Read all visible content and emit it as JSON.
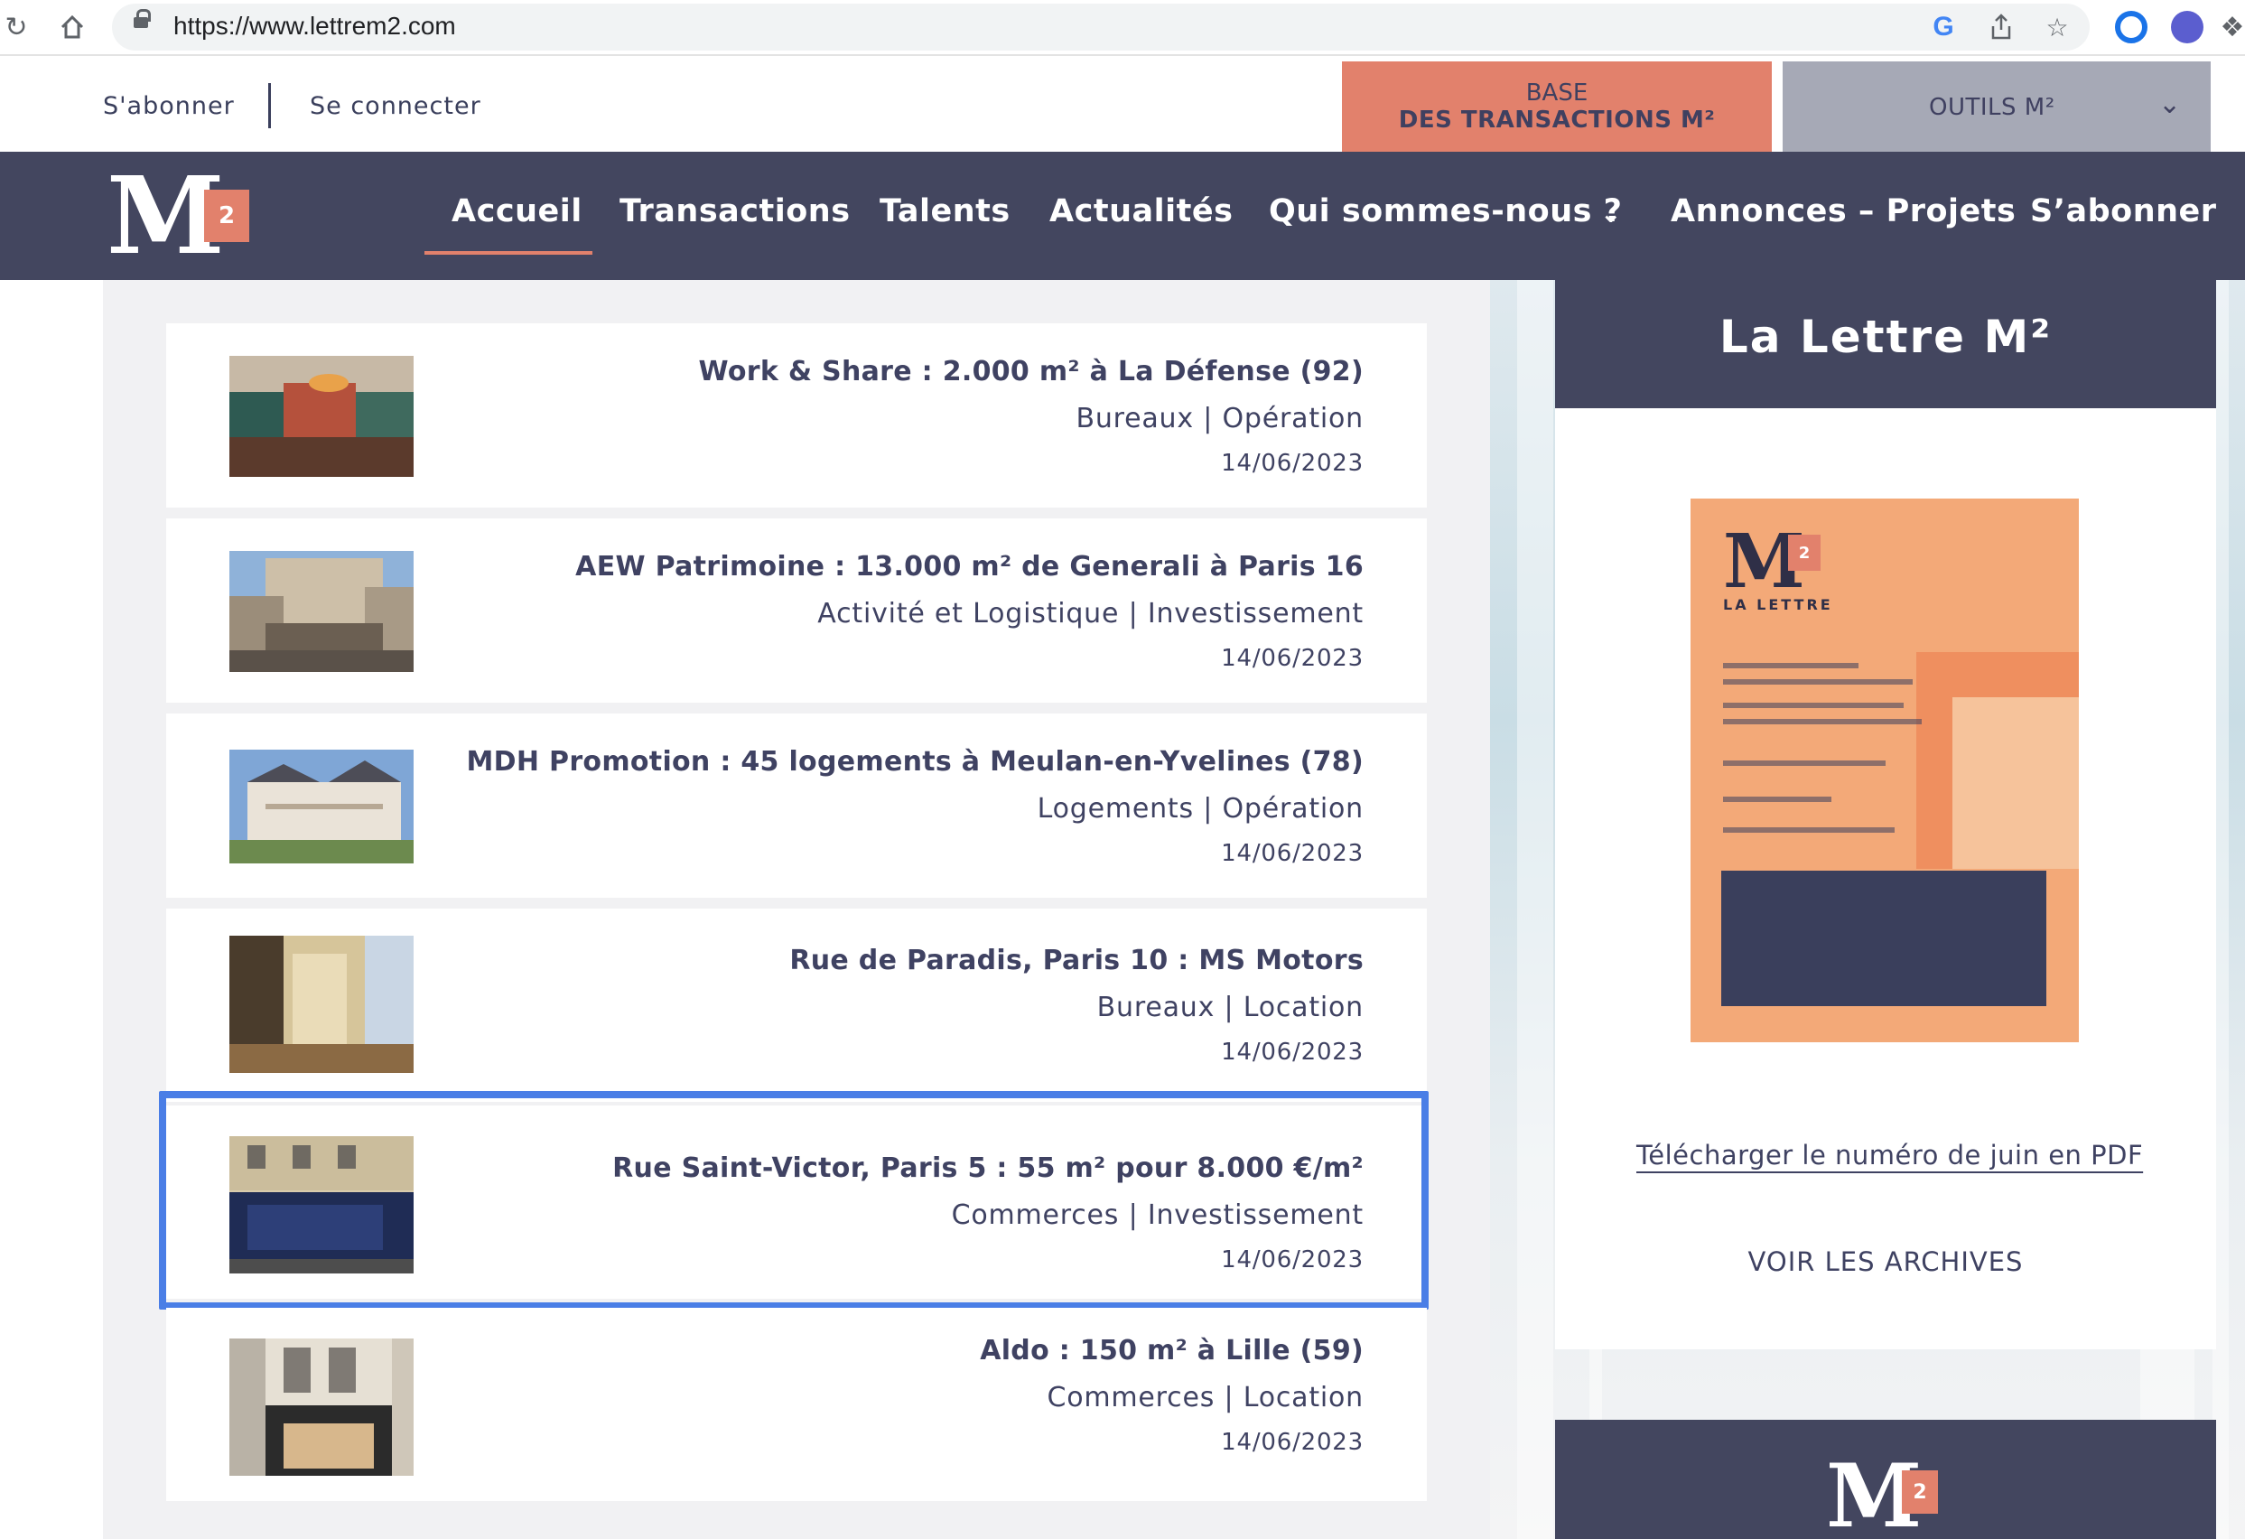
{
  "browser": {
    "url": "https://www.lettrem2.com",
    "icons": [
      "reload-icon",
      "home-icon",
      "lock-icon",
      "google-icon",
      "share-icon",
      "star-icon",
      "extension-icon"
    ]
  },
  "topbar": {
    "subscribe": "S'abonner",
    "login": "Se connecter",
    "base_line1": "BASE",
    "base_line2": "DES TRANSACTIONS M²",
    "outils": "OUTILS M²"
  },
  "nav": {
    "logo_letter": "M",
    "logo_badge": "2",
    "items": [
      "Accueil",
      "Transactions",
      "Talents",
      "Actualités",
      "Qui sommes-nous ?",
      "Annonces – Projets",
      "S’abonner"
    ],
    "active": "Accueil"
  },
  "articles": [
    {
      "title": "Work & Share : 2.000 m² à La Défense (92)",
      "category": "Bureaux | Opération",
      "date": "14/06/2023"
    },
    {
      "title": "AEW Patrimoine : 13.000 m² de Generali à Paris 16",
      "category": "Activité et Logistique | Investissement",
      "date": "14/06/2023"
    },
    {
      "title": "MDH Promotion : 45 logements à Meulan-en-Yvelines (78)",
      "category": "Logements | Opération",
      "date": "14/06/2023"
    },
    {
      "title": "Rue de Paradis, Paris 10 : MS Motors",
      "category": "Bureaux | Location",
      "date": "14/06/2023"
    },
    {
      "title": "Rue Saint-Victor, Paris 5 : 55 m² pour 8.000 €/m²",
      "category": "Commerces | Investissement",
      "date": "14/06/2023"
    },
    {
      "title": "Aldo : 150 m² à Lille (59)",
      "category": "Commerces | Location",
      "date": "14/06/2023"
    }
  ],
  "sidebar": {
    "title": "La Lettre M²",
    "cover_title": "LA LETTRE",
    "download": "Télécharger le numéro de juin en PDF",
    "archives": "VOIR LES ARCHIVES"
  },
  "colors": {
    "navy": "#43465f",
    "coral": "#e2816c",
    "grey_button": "#a6a9b6",
    "highlight": "#4a7ee6"
  }
}
